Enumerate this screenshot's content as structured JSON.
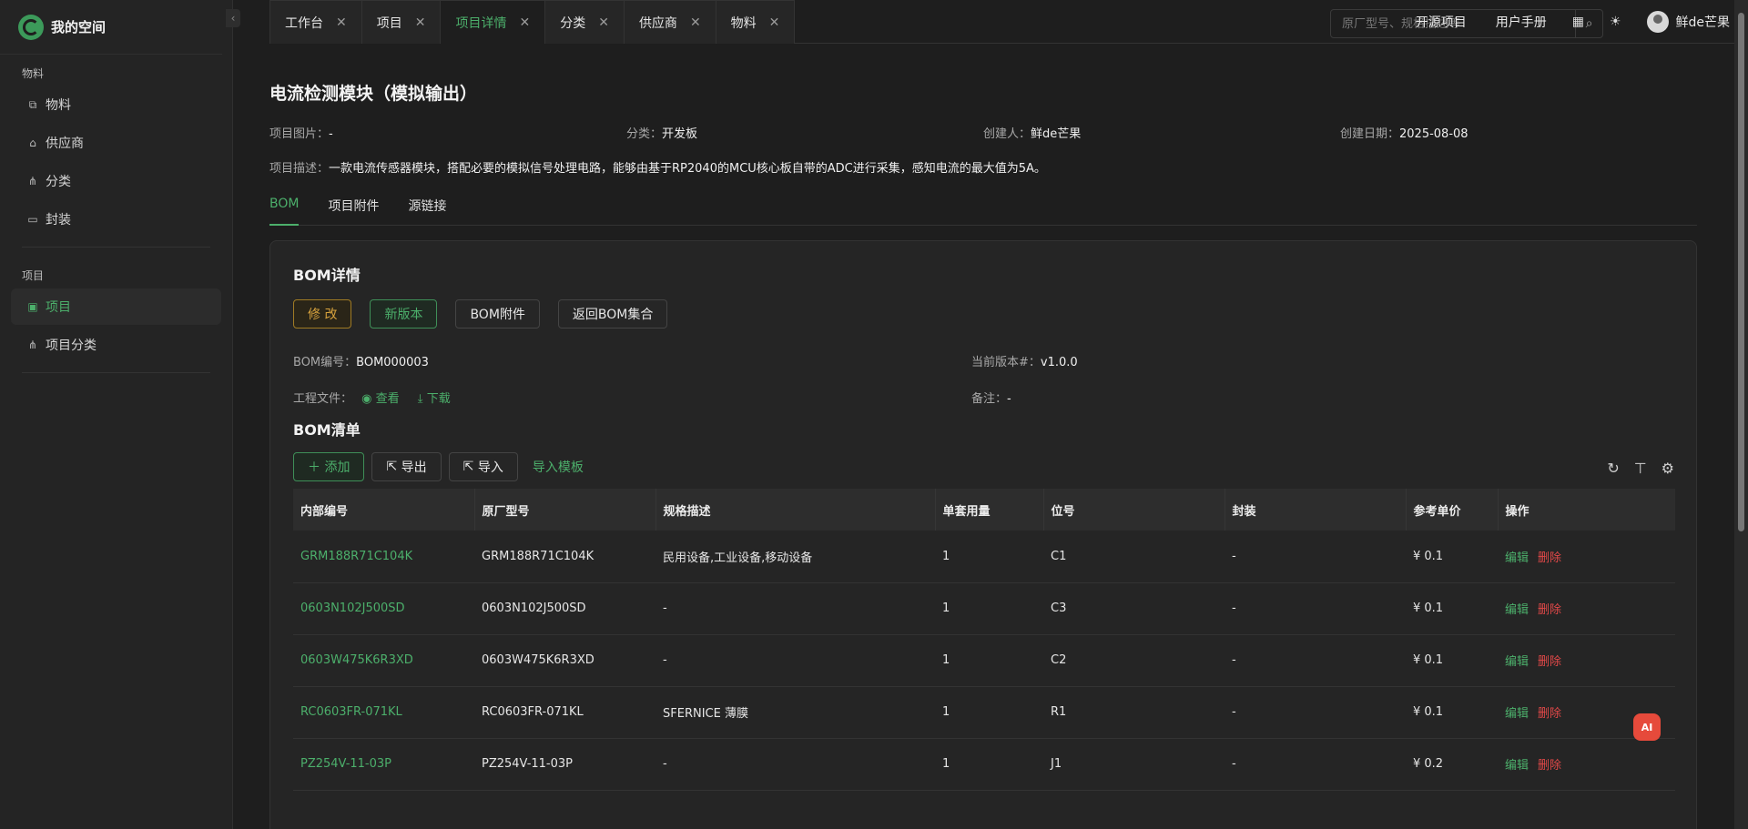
{
  "sidebar": {
    "brand": "我的空间",
    "groups": [
      {
        "label": "物料",
        "items": [
          {
            "label": "物料",
            "icon": "material-icon"
          },
          {
            "label": "供应商",
            "icon": "supplier-icon"
          },
          {
            "label": "分类",
            "icon": "category-icon"
          },
          {
            "label": "封装",
            "icon": "package-icon"
          }
        ]
      },
      {
        "label": "项目",
        "items": [
          {
            "label": "项目",
            "icon": "project-icon",
            "active": true
          },
          {
            "label": "项目分类",
            "icon": "category-icon"
          }
        ]
      }
    ]
  },
  "tabs": [
    {
      "label": "工作台"
    },
    {
      "label": "项目"
    },
    {
      "label": "项目详情",
      "active": true
    },
    {
      "label": "分类"
    },
    {
      "label": "供应商"
    },
    {
      "label": "物料"
    }
  ],
  "header": {
    "search_placeholder": "原厂型号、规格描述等",
    "links": [
      "开源项目",
      "用户手册"
    ],
    "user_name": "鲜de芒果"
  },
  "project": {
    "title": "电流检测模块（模拟输出）",
    "image_label": "项目图片：",
    "image_value": "-",
    "category_label": "分类：",
    "category_value": "开发板",
    "creator_label": "创建人：",
    "creator_value": "鲜de芒果",
    "date_label": "创建日期：",
    "date_value": "2025-08-08",
    "desc_label": "项目描述：",
    "desc_value": "一款电流传感器模块，搭配必要的模拟信号处理电路，能够由基于RP2040的MCU核心板自带的ADC进行采集，感知电流的最大值为5A。"
  },
  "sub_tabs": [
    "BOM",
    "项目附件",
    "源链接"
  ],
  "bom": {
    "title": "BOM详情",
    "buttons": [
      "修 改",
      "新版本",
      "BOM附件",
      "返回BOM集合"
    ],
    "code_label": "BOM编号：",
    "code_value": "BOM000003",
    "version_label": "当前版本#：",
    "version_value": "v1.0.0",
    "files_label": "工程文件：",
    "view_label": "查看",
    "download_label": "下载",
    "note_label": "备注：",
    "note_value": "-",
    "list_title": "BOM清单",
    "add_label": "添加",
    "export_label": "导出",
    "import_label": "导入",
    "template_label": "导入模板"
  },
  "table": {
    "columns": [
      "内部编号",
      "原厂型号",
      "规格描述",
      "单套用量",
      "位号",
      "封装",
      "参考单价",
      "操作"
    ],
    "rows": [
      [
        "GRM188R71C104K",
        "GRM188R71C104K",
        "民用设备,工业设备,移动设备",
        "1",
        "C1",
        "-",
        "¥ 0.1"
      ],
      [
        "0603N102J500SD",
        "0603N102J500SD",
        "-",
        "1",
        "C3",
        "-",
        "¥ 0.1"
      ],
      [
        "0603W475K6R3XD",
        "0603W475K6R3XD",
        "-",
        "1",
        "C2",
        "-",
        "¥ 0.1"
      ],
      [
        "RC0603FR-071KL",
        "RC0603FR-071KL",
        "SFERNICE 薄膜",
        "1",
        "R1",
        "-",
        "¥ 0.1"
      ],
      [
        "PZ254V-11-03P",
        "PZ254V-11-03P",
        "-",
        "1",
        "J1",
        "-",
        "¥ 0.2"
      ]
    ],
    "edit_label": "编辑",
    "delete_label": "删除"
  },
  "ai_badge": "AI",
  "colors": {
    "accent": "#4caf6b",
    "danger": "#e04848",
    "warning": "#d7a23d",
    "background": "#1e1e1e"
  }
}
